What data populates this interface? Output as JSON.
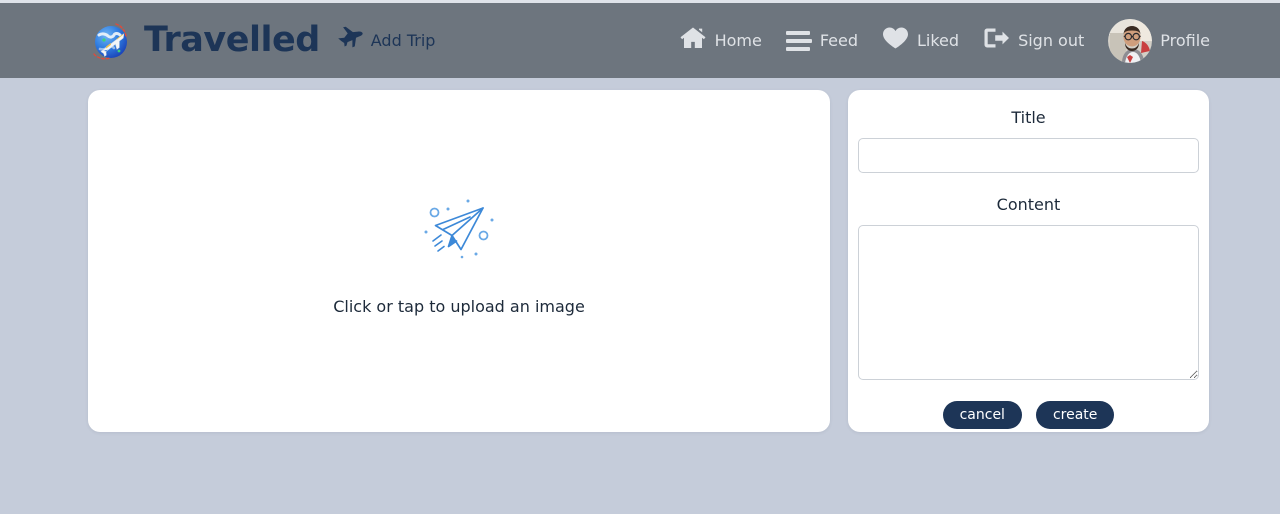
{
  "brand": {
    "name": "Travelled",
    "logo_icon": "globe-airplane-icon",
    "logo_colors": {
      "globe_blue": "#2f7ce0",
      "plane_white": "#f4f6f8",
      "path_red": "#e04a3a"
    }
  },
  "header": {
    "background": "#6d757e",
    "accent": "#1d3557",
    "add_trip": {
      "label": "Add Trip",
      "icon": "airplane-icon"
    },
    "nav": [
      {
        "label": "Home",
        "icon": "home-icon"
      },
      {
        "label": "Feed",
        "icon": "hamburger-icon"
      },
      {
        "label": "Liked",
        "icon": "heart-icon"
      },
      {
        "label": "Sign out",
        "icon": "sign-out-icon"
      },
      {
        "label": "Profile",
        "icon": "avatar-image"
      }
    ]
  },
  "upload": {
    "prompt": "Click or tap to upload an image",
    "icon": "paper-plane-icon",
    "icon_color": "#3d89d8"
  },
  "form": {
    "title_label": "Title",
    "title_value": "",
    "title_placeholder": "",
    "content_label": "Content",
    "content_value": "",
    "content_placeholder": "",
    "cancel_label": "cancel",
    "create_label": "create",
    "button_color": "#1d3557"
  },
  "page": {
    "background": "#c5ccda",
    "card_background": "#ffffff"
  }
}
